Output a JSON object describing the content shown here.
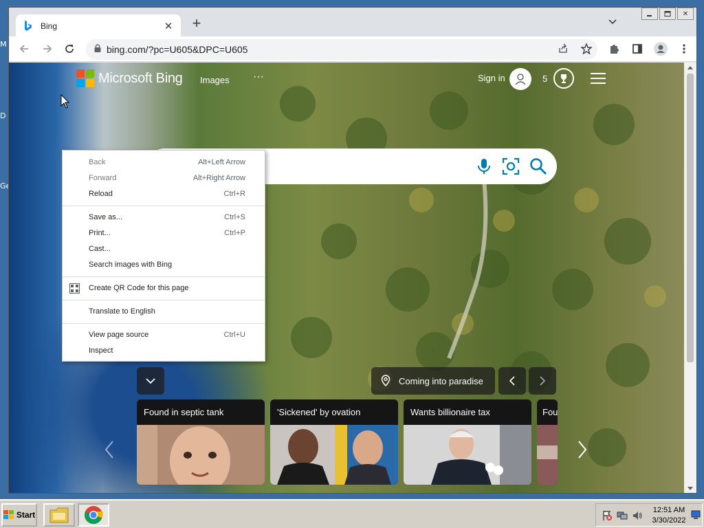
{
  "desktop": {
    "labels": [
      "M",
      "D",
      "Ge"
    ]
  },
  "window": {
    "controls": [
      "minimize",
      "maximize",
      "close"
    ]
  },
  "tab": {
    "title": "Bing",
    "favicon": "bing-logo-icon"
  },
  "address_bar": {
    "url": "bing.com/?pc=U605&DPC=U605"
  },
  "bing": {
    "logo_text": "Microsoft Bing",
    "nav_images": "Images",
    "nav_more": "···",
    "sign_in": "Sign in",
    "rewards_count": "5"
  },
  "context_menu": {
    "items": [
      {
        "label": "Back",
        "shortcut": "Alt+Left Arrow",
        "disabled": true
      },
      {
        "label": "Forward",
        "shortcut": "Alt+Right Arrow",
        "disabled": true
      },
      {
        "label": "Reload",
        "shortcut": "Ctrl+R",
        "disabled": false
      },
      {
        "label": "Save as...",
        "shortcut": "Ctrl+S",
        "disabled": false
      },
      {
        "label": "Print...",
        "shortcut": "Ctrl+P",
        "disabled": false
      },
      {
        "label": "Cast...",
        "shortcut": "",
        "disabled": false
      },
      {
        "label": "Search images with Bing",
        "shortcut": "",
        "disabled": false
      },
      {
        "label": "Create QR Code for this page",
        "shortcut": "",
        "disabled": false
      },
      {
        "label": "Translate to English",
        "shortcut": "",
        "disabled": false
      },
      {
        "label": "View page source",
        "shortcut": "Ctrl+U",
        "disabled": false
      },
      {
        "label": "Inspect",
        "shortcut": "",
        "disabled": false
      }
    ]
  },
  "image_of_day": {
    "location": "Coming into paradise"
  },
  "news": [
    {
      "title": "Found in septic tank"
    },
    {
      "title": "'Sickened' by ovation"
    },
    {
      "title": "Wants billionaire tax"
    },
    {
      "title": "Fou"
    }
  ],
  "taskbar": {
    "start_label": "Start",
    "time": "12:51 AM",
    "date": "3/30/2022"
  },
  "colors": {
    "bing_accent": "#007daa",
    "taskbar": "#d4d0c8"
  }
}
